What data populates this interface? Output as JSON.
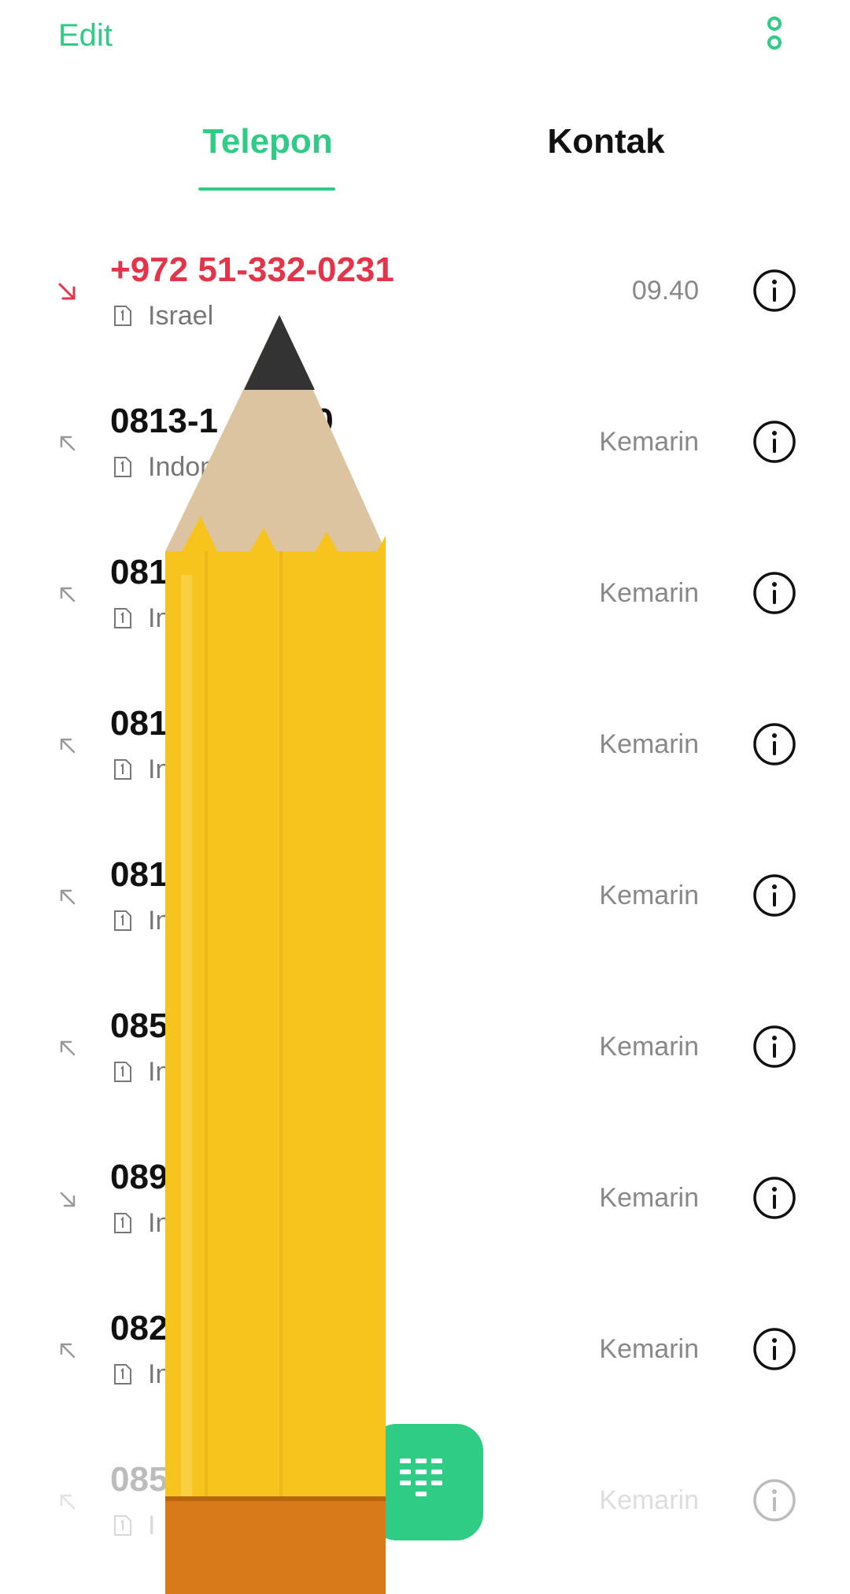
{
  "header": {
    "edit_label": "Edit"
  },
  "tabs": [
    {
      "label": "Telepon",
      "active": true
    },
    {
      "label": "Kontak",
      "active": false
    }
  ],
  "calls": [
    {
      "number": "+972 51-332-0231",
      "region": "Israel",
      "time": "09.40",
      "direction": "incoming-missed"
    },
    {
      "number": "0813-1      680",
      "region": "Indon",
      "time": "Kemarin",
      "direction": "outgoing"
    },
    {
      "number": "081              6",
      "region": "In",
      "time": "Kemarin",
      "direction": "outgoing"
    },
    {
      "number": "081              6",
      "region": "In",
      "time": "Kemarin",
      "direction": "outgoing"
    },
    {
      "number": "081              3",
      "region": "In",
      "time": "Kemarin",
      "direction": "outgoing"
    },
    {
      "number": "085              1",
      "region": "In",
      "time": "Kemarin",
      "direction": "outgoing"
    },
    {
      "number": "089              3",
      "region": "In",
      "time": "Kemarin",
      "direction": "incoming"
    },
    {
      "number": "082              6",
      "region": "In",
      "time": "Kemarin",
      "direction": "outgoing"
    },
    {
      "number": "085",
      "region": "I",
      "time": "Kemarin",
      "direction": "outgoing"
    }
  ],
  "icons": {
    "more": "more-vertical-icon",
    "missed": "missed-call-arrow-icon",
    "outgoing": "outgoing-call-arrow-icon",
    "incoming": "incoming-call-arrow-icon",
    "sim": "sim-1-icon",
    "info": "info-icon",
    "dialpad": "dialpad-icon",
    "overlay": "pencil-illustration"
  },
  "colors": {
    "accent": "#2ecc84",
    "missed": "#e5344a",
    "text": "#111111",
    "secondary_text": "#888888",
    "pencil_body": "#f7c31d",
    "pencil_wood": "#dcc4a0",
    "pencil_lead": "#333333",
    "pencil_ferrule": "#d97a1a"
  }
}
